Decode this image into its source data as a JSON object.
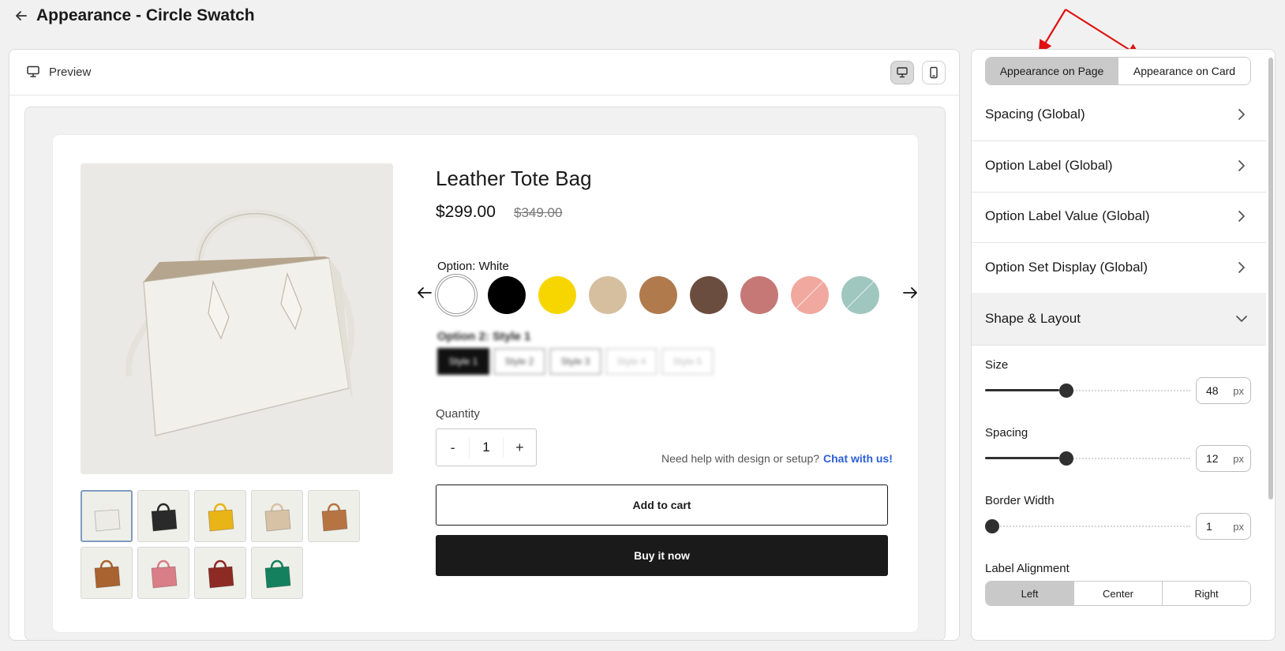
{
  "header": {
    "title": "Appearance - Circle Swatch"
  },
  "preview": {
    "label": "Preview"
  },
  "product": {
    "title": "Leather Tote Bag",
    "price": "$299.00",
    "compare_price": "$349.00",
    "option_label": "Option: White",
    "swatches": [
      {
        "color": "#ffffff",
        "selected": true,
        "unavailable": false
      },
      {
        "color": "#000000",
        "selected": false,
        "unavailable": false
      },
      {
        "color": "#f7d600",
        "selected": false,
        "unavailable": false
      },
      {
        "color": "#d6bf9f",
        "selected": false,
        "unavailable": false
      },
      {
        "color": "#b07a4c",
        "selected": false,
        "unavailable": false
      },
      {
        "color": "#6a4d3e",
        "selected": false,
        "unavailable": false
      },
      {
        "color": "#c67876",
        "selected": false,
        "unavailable": false
      },
      {
        "color": "#f0a89f",
        "selected": false,
        "unavailable": true
      },
      {
        "color": "#9fc7bf",
        "selected": false,
        "unavailable": true
      }
    ],
    "option2": {
      "label": "Option 2: Style 1",
      "values": [
        "Style 1",
        "Style 2",
        "Style 3",
        "Style 4",
        "Style 5"
      ]
    },
    "quantity_label": "Quantity",
    "quantity": {
      "minus": "-",
      "value": "1",
      "plus": "+"
    },
    "help_text": "Need help with design or setup?",
    "help_link": "Chat with us!",
    "add_to_cart": "Add to cart",
    "buy_now": "Buy it now",
    "thumbnails": [
      {
        "color": "#ecebe6"
      },
      {
        "color": "#2a2a2a"
      },
      {
        "color": "#e9b416"
      },
      {
        "color": "#d8c2a6"
      },
      {
        "color": "#b77443"
      },
      {
        "color": "#a86330"
      },
      {
        "color": "#d97d86"
      },
      {
        "color": "#8d2a24"
      },
      {
        "color": "#15805e"
      }
    ]
  },
  "settings": {
    "tabs": [
      "Appearance on Page",
      "Appearance on Card"
    ],
    "active_tab": 0,
    "sections": [
      "Spacing (Global)",
      "Option Label (Global)",
      "Option Label Value (Global)",
      "Option Set Display (Global)",
      "Shape & Layout"
    ],
    "size": {
      "label": "Size",
      "value": "48",
      "unit": "px",
      "level": 0.36
    },
    "spacing": {
      "label": "Spacing",
      "value": "12",
      "unit": "px",
      "level": 0.36
    },
    "border_width": {
      "label": "Border Width",
      "value": "1",
      "unit": "px",
      "level": 0.0
    },
    "label_alignment": {
      "label": "Label Alignment",
      "options": [
        "Left",
        "Center",
        "Right"
      ],
      "selected": 0
    }
  },
  "colors": {
    "accent_link": "#2b5fd9",
    "annotation_arrow": "#e01010",
    "dark_button": "#1a1a1a"
  }
}
